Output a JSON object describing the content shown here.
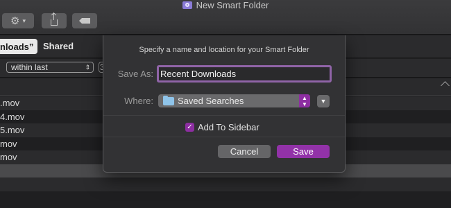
{
  "window": {
    "title": "New Smart Folder",
    "title_icon": "smart-folder-icon"
  },
  "toolbar": {
    "action_icon": "gear-icon",
    "action_chevron": "⌄",
    "share_icon": "share-icon",
    "tag_icon": "tag-icon"
  },
  "scope": {
    "selected_label": "nloads”",
    "shared_label": "Shared"
  },
  "criteria": {
    "operator_value": "within last",
    "operator_arrows": "⌃⌄",
    "number_value": "3"
  },
  "files": [
    {
      "name": ".mov"
    },
    {
      "name": "4.mov"
    },
    {
      "name": "5.mov"
    },
    {
      "name": "mov"
    },
    {
      "name": "mov"
    }
  ],
  "dialog": {
    "prompt": "Specify a name and location for your Smart Folder",
    "save_as_label": "Save As:",
    "save_as_value": "Recent Downloads",
    "where_label": "Where:",
    "where_value": "Saved Searches",
    "where_icon": "blue-folder-icon",
    "add_to_sidebar_label": "Add To Sidebar",
    "add_to_sidebar_checked": true,
    "cancel_label": "Cancel",
    "save_label": "Save"
  },
  "colors": {
    "accent": "#9232a8",
    "focus_ring": "#9064a8",
    "folder_blue": "#8fc4ea"
  }
}
